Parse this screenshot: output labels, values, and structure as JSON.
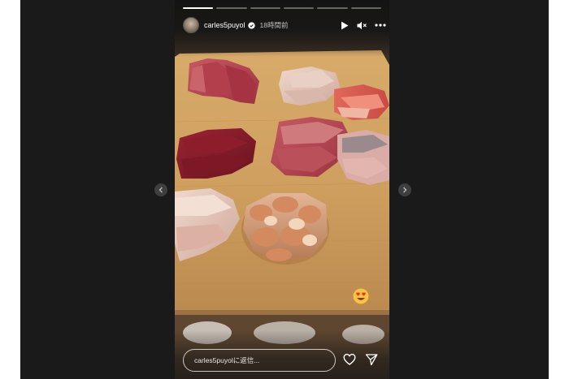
{
  "story": {
    "username": "carles5puyol",
    "timestamp": "18時間前",
    "segments_progress": [
      1,
      0,
      0,
      0,
      0,
      0
    ],
    "reply_placeholder": "carles5puyolに返信..."
  },
  "icons": {
    "play": "play-icon",
    "mute": "speaker-muted-icon",
    "more": "more-dots-icon",
    "heart": "heart-icon",
    "send": "paper-plane-icon",
    "prev": "chevron-left-icon",
    "next": "chevron-right-icon",
    "verified": "verified-badge-icon",
    "emoji": "heart-eyes-emoji"
  },
  "colors": {
    "viewer_background": "#1a1a1a",
    "board": "#c79a5c"
  }
}
